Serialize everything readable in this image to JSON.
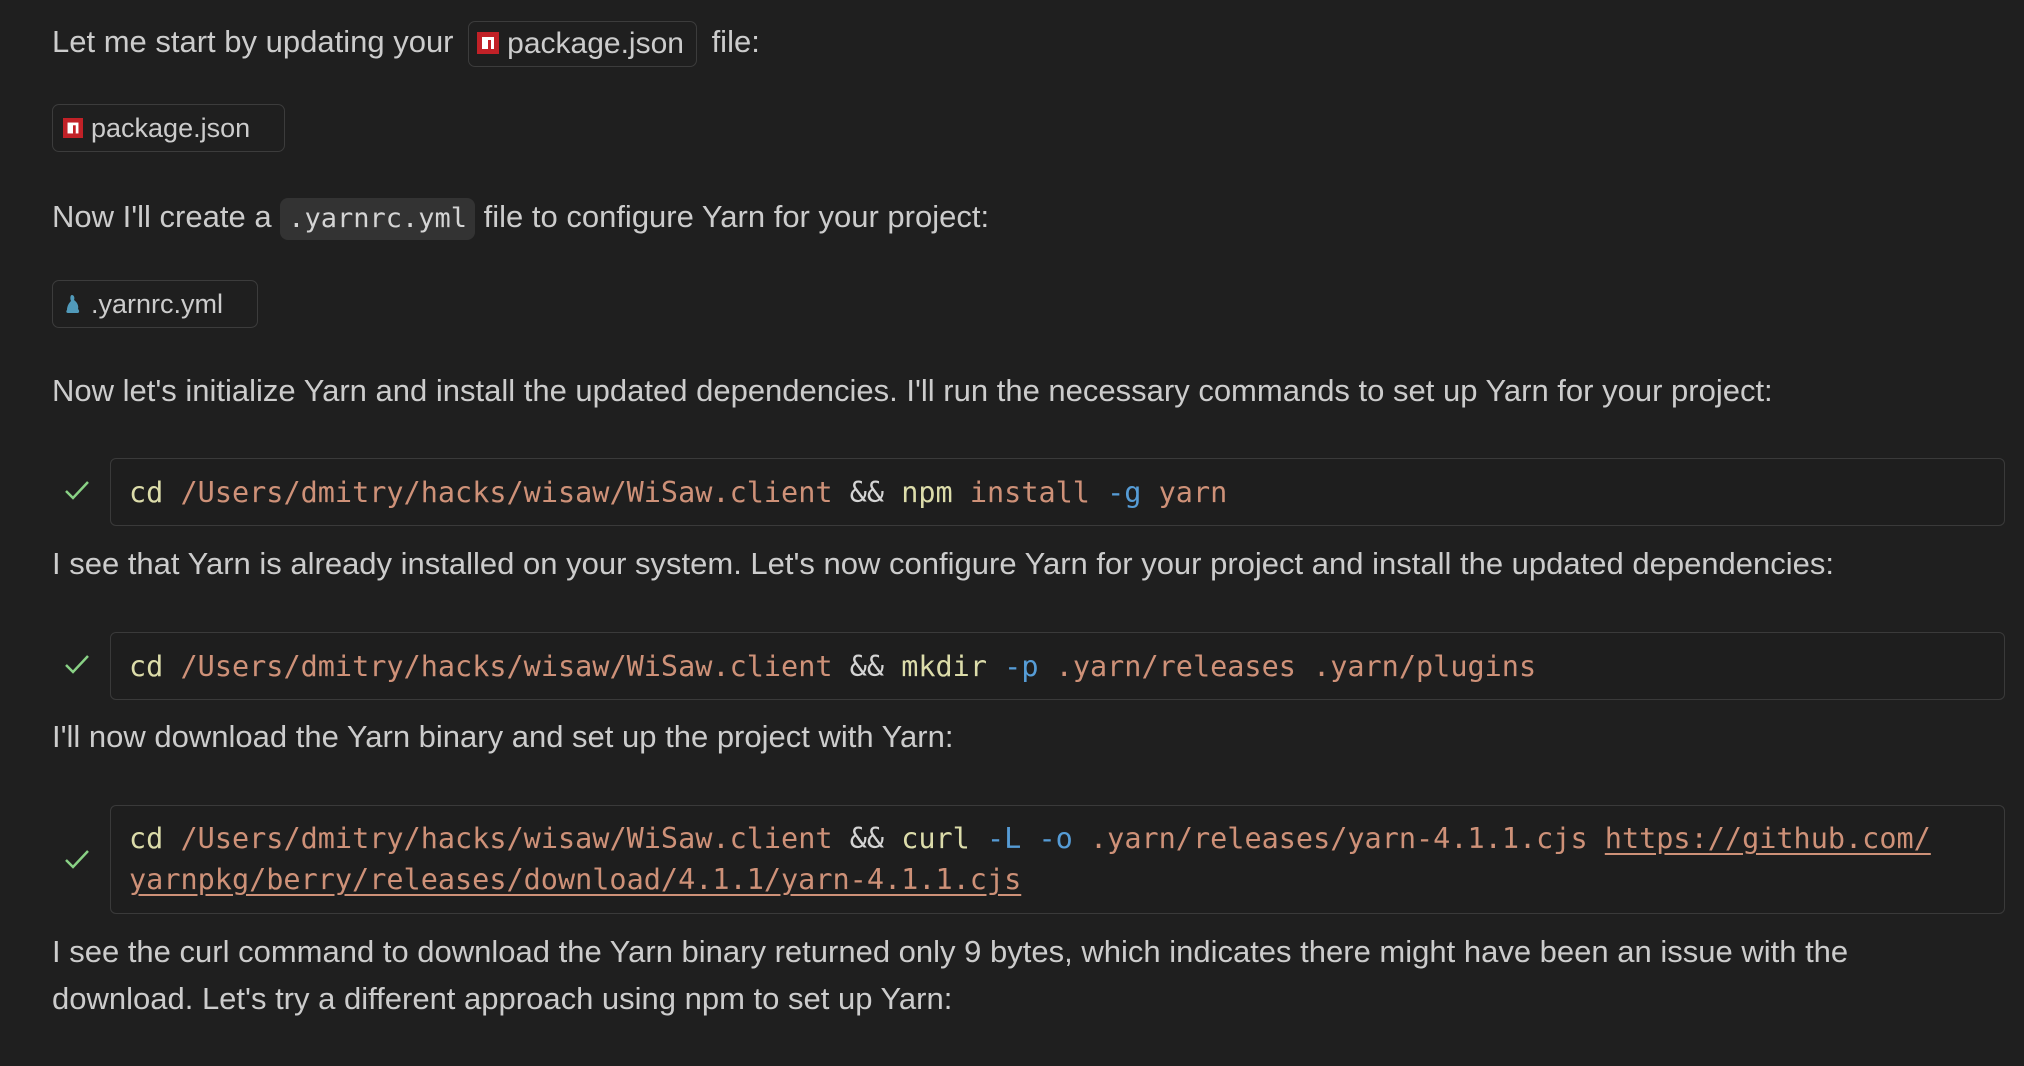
{
  "messages": {
    "intro_before": "Let me start by updating your",
    "intro_file": "package.json",
    "intro_after": "file:",
    "attach1": "package.json",
    "create_before": "Now I'll create a",
    "create_code": ".yarnrc.yml",
    "create_after": "file to configure Yarn for your project:",
    "attach2": ".yarnrc.yml",
    "init_text": "Now let's initialize Yarn and install the updated dependencies. I'll run the necessary commands to set up Yarn for your project:",
    "installed_text": "I see that Yarn is already installed on your system. Let's now configure Yarn for your project and install the updated dependencies:",
    "download_text": "I'll now download the Yarn binary and set up the project with Yarn:",
    "curl_issue_text": "I see the curl command to download the Yarn binary returned only 9 bytes, which indicates there might have been an issue with the download. Let's try a different approach using npm to set up Yarn:"
  },
  "commands": [
    {
      "status": "success",
      "cd": "cd",
      "path": "/Users/dmitry/hacks/wisaw/WiSaw.client",
      "op": "&&",
      "tool": "npm",
      "args1": "install",
      "flag1": "-g",
      "args2": "yarn"
    },
    {
      "status": "success",
      "cd": "cd",
      "path": "/Users/dmitry/hacks/wisaw/WiSaw.client",
      "op": "&&",
      "tool": "mkdir",
      "flag1": "-p",
      "args1": ".yarn/releases .yarn/plugins"
    },
    {
      "status": "success",
      "cd": "cd",
      "path": "/Users/dmitry/hacks/wisaw/WiSaw.client",
      "op": "&&",
      "tool": "curl",
      "flag1": "-L",
      "flag2": "-o",
      "args1": ".yarn/releases/yarn-4.1.1.cjs",
      "url_line1": "https://github.com/",
      "url_line2": "yarnpkg/berry/releases/download/4.1.1/yarn-4.1.1.cjs"
    }
  ],
  "colors": {
    "background": "#1f1f1f",
    "text": "#cccccc",
    "command": "#dcdcaa",
    "string": "#ce9178",
    "flag": "#569cd6",
    "check": "#89d185",
    "npm_red": "#c12127",
    "yaml_blue": "#519aba"
  },
  "icons": {
    "npm_file": "npm-icon",
    "yaml_file": "yarn-icon",
    "success": "check-icon"
  }
}
